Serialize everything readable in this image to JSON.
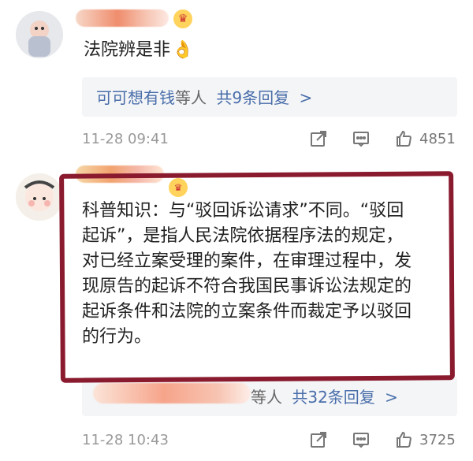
{
  "comments": [
    {
      "text": "法院辨是非",
      "emoji": "👌",
      "reply_summary": {
        "user": "可可想有钱",
        "suffix": "等人",
        "count": "共9条回复",
        "arrow": ">"
      },
      "time": "11-28 09:41",
      "likes": "4851",
      "icons": {
        "share": "share-icon",
        "comment": "comment-icon",
        "like": "thumbs-up-icon"
      }
    },
    {
      "text_lines": [
        "科普知识：与“驳回诉讼请求”不同。“驳回",
        "起诉”，是指人民法院依据程序法的规定，",
        "对已经立案受理的案件，在审理过程中，发",
        "现原告的起诉不符合我国民事诉讼法规定的",
        "起诉条件和法院的立案条件而裁定予以驳回",
        "的行为。"
      ],
      "reply_summary": {
        "suffix": "等人",
        "count": "共32条回复",
        "arrow": ">"
      },
      "time": "11-28 10:43",
      "likes": "3725",
      "icons": {
        "share": "share-icon",
        "comment": "comment-icon",
        "like": "thumbs-up-icon"
      }
    }
  ],
  "colors": {
    "link": "#496eaa",
    "meta": "#999999",
    "highlight": "#8a1a2e",
    "reply_bg": "#f4f5f7"
  }
}
